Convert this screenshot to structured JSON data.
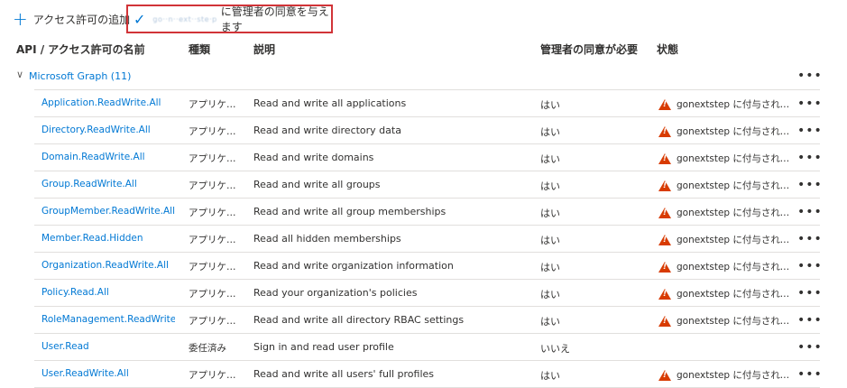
{
  "toolbar": {
    "add_permission_label": "アクセス許可の追加",
    "grant_tenant_blurred": "go··n··ext··ste·p",
    "grant_consent_label": "に管理者の同意を与えます"
  },
  "columns": {
    "api": "API / アクセス許可の名前",
    "type": "種類",
    "description": "説明",
    "admin_consent": "管理者の同意が必要",
    "status": "状態"
  },
  "group": {
    "label": "Microsoft Graph (11)",
    "more": "•••"
  },
  "rows": [
    {
      "api": "Application.ReadWrite.All",
      "type": "アプリケーシ...",
      "desc": "Read and write all applications",
      "admin": "はい",
      "status": "gonextstep に付与されて...",
      "warn": true,
      "more": "•••"
    },
    {
      "api": "Directory.ReadWrite.All",
      "type": "アプリケーシ...",
      "desc": "Read and write directory data",
      "admin": "はい",
      "status": "gonextstep に付与されて...",
      "warn": true,
      "more": "•••"
    },
    {
      "api": "Domain.ReadWrite.All",
      "type": "アプリケーシ...",
      "desc": "Read and write domains",
      "admin": "はい",
      "status": "gonextstep に付与されて...",
      "warn": true,
      "more": "•••"
    },
    {
      "api": "Group.ReadWrite.All",
      "type": "アプリケーシ...",
      "desc": "Read and write all groups",
      "admin": "はい",
      "status": "gonextstep に付与されて...",
      "warn": true,
      "more": "•••"
    },
    {
      "api": "GroupMember.ReadWrite.All",
      "type": "アプリケーシ...",
      "desc": "Read and write all group memberships",
      "admin": "はい",
      "status": "gonextstep に付与されて...",
      "warn": true,
      "more": "•••"
    },
    {
      "api": "Member.Read.Hidden",
      "type": "アプリケーシ...",
      "desc": "Read all hidden memberships",
      "admin": "はい",
      "status": "gonextstep に付与されて...",
      "warn": true,
      "more": "•••"
    },
    {
      "api": "Organization.ReadWrite.All",
      "type": "アプリケーシ...",
      "desc": "Read and write organization information",
      "admin": "はい",
      "status": "gonextstep に付与されて...",
      "warn": true,
      "more": "•••"
    },
    {
      "api": "Policy.Read.All",
      "type": "アプリケーシ...",
      "desc": "Read your organization's policies",
      "admin": "はい",
      "status": "gonextstep に付与されて...",
      "warn": true,
      "more": "•••"
    },
    {
      "api": "RoleManagement.ReadWrite.Dir",
      "type": "アプリケーシ...",
      "desc": "Read and write all directory RBAC settings",
      "admin": "はい",
      "status": "gonextstep に付与されて...",
      "warn": true,
      "more": "•••"
    },
    {
      "api": "User.Read",
      "type": "委任済み",
      "desc": "Sign in and read user profile",
      "admin": "いいえ",
      "status": "",
      "warn": false,
      "more": "•••"
    },
    {
      "api": "User.ReadWrite.All",
      "type": "アプリケーシ...",
      "desc": "Read and write all users' full profiles",
      "admin": "はい",
      "status": "gonextstep に付与されて...",
      "warn": true,
      "more": "•••"
    }
  ]
}
